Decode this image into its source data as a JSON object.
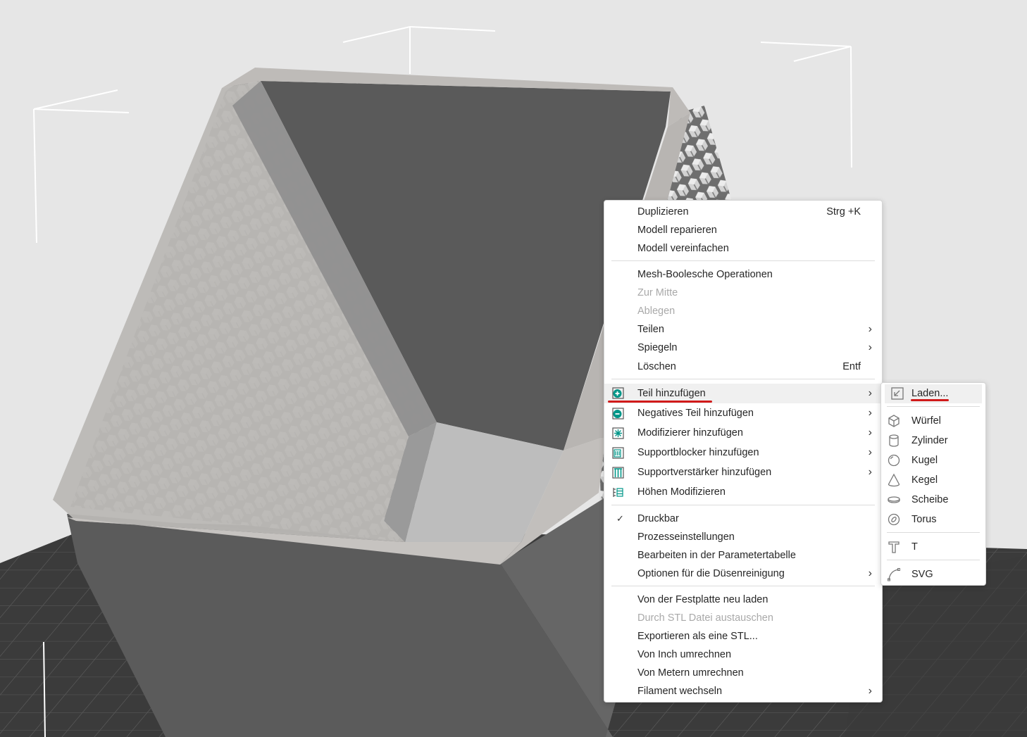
{
  "context_menu": {
    "items": [
      {
        "label": "Duplizieren",
        "shortcut": "Strg +K"
      },
      {
        "label": "Modell reparieren"
      },
      {
        "label": "Modell vereinfachen"
      },
      {
        "label": "Mesh-Boolesche Operationen"
      },
      {
        "label": "Zur Mitte",
        "disabled": true
      },
      {
        "label": "Ablegen",
        "disabled": true
      },
      {
        "label": "Teilen",
        "submenu": true
      },
      {
        "label": "Spiegeln",
        "submenu": true
      },
      {
        "label": "Löschen",
        "shortcut": "Entf"
      },
      {
        "label": "Teil hinzufügen",
        "submenu": true,
        "icon": "add-part-icon",
        "highlighted": true
      },
      {
        "label": "Negatives Teil hinzufügen",
        "submenu": true,
        "icon": "negative-part-icon"
      },
      {
        "label": "Modifizierer hinzufügen",
        "submenu": true,
        "icon": "modifier-icon"
      },
      {
        "label": "Supportblocker hinzufügen",
        "submenu": true,
        "icon": "support-blocker-icon"
      },
      {
        "label": "Supportverstärker hinzufügen",
        "submenu": true,
        "icon": "support-enforcer-icon"
      },
      {
        "label": "Höhen Modifizieren",
        "icon": "height-modifier-icon"
      },
      {
        "label": "Druckbar",
        "checked": true
      },
      {
        "label": "Prozesseinstellungen"
      },
      {
        "label": "Bearbeiten in der Parametertabelle"
      },
      {
        "label": "Optionen für die Düsenreinigung",
        "submenu": true
      },
      {
        "label": "Von der Festplatte neu laden"
      },
      {
        "label": "Durch STL Datei austauschen",
        "disabled": true
      },
      {
        "label": "Exportieren als eine STL..."
      },
      {
        "label": "Von Inch umrechnen"
      },
      {
        "label": "Von Metern umrechnen"
      },
      {
        "label": "Filament wechseln",
        "submenu": true
      }
    ],
    "submenu_arrow": "›",
    "check_mark": "✓"
  },
  "submenu": {
    "items": [
      {
        "label": "Laden...",
        "icon": "load-file-icon",
        "highlighted": true
      },
      {
        "label": "Würfel",
        "icon": "cube-icon"
      },
      {
        "label": "Zylinder",
        "icon": "cylinder-icon"
      },
      {
        "label": "Kugel",
        "icon": "sphere-icon"
      },
      {
        "label": "Kegel",
        "icon": "cone-icon"
      },
      {
        "label": "Scheibe",
        "icon": "disc-icon"
      },
      {
        "label": "Torus",
        "icon": "torus-icon"
      },
      {
        "label": "T",
        "icon": "text-icon"
      },
      {
        "label": "SVG",
        "icon": "svg-curve-icon"
      }
    ]
  },
  "colors": {
    "accent_green": "#009688",
    "annotation_red": "#d11a1a",
    "model_gray": "#5c5c5c",
    "plate_dark": "#3a3a3a"
  }
}
